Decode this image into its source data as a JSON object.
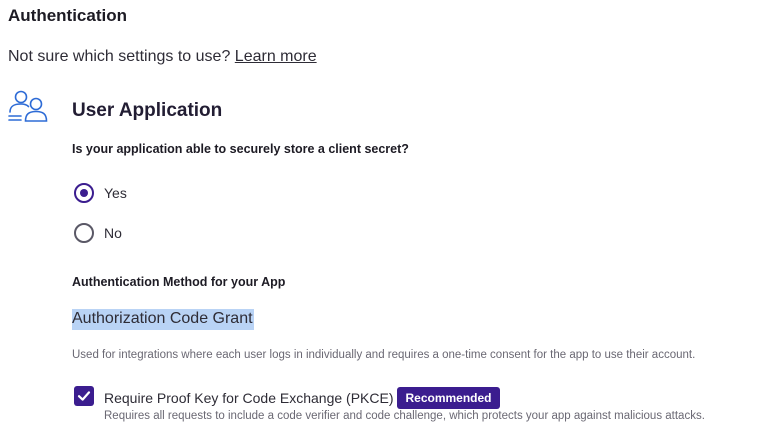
{
  "section": {
    "title": "Authentication",
    "intro_text": "Not sure which settings to use?",
    "learn_more_link": "Learn more"
  },
  "app_type": {
    "icon": "users-icon",
    "title": "User Application"
  },
  "secret_question": {
    "label": "Is your application able to securely store a client secret?",
    "options": [
      {
        "label": "Yes",
        "selected": true
      },
      {
        "label": "No",
        "selected": false
      }
    ]
  },
  "auth_method": {
    "heading": "Authentication Method for your App",
    "name": "Authorization Code Grant",
    "description": "Used for integrations where each user logs in individually and requires a one-time consent for the app to use their account."
  },
  "pkce": {
    "checked": true,
    "label": "Require Proof Key for Code Exchange (PKCE)",
    "badge": "Recommended",
    "description": "Requires all requests to include a code verifier and code challenge, which protects your app against malicious attacks."
  },
  "colors": {
    "accent": "#3b1d8f",
    "selection_highlight": "#b9d3f5",
    "icon_blue": "#2d6bd6"
  }
}
